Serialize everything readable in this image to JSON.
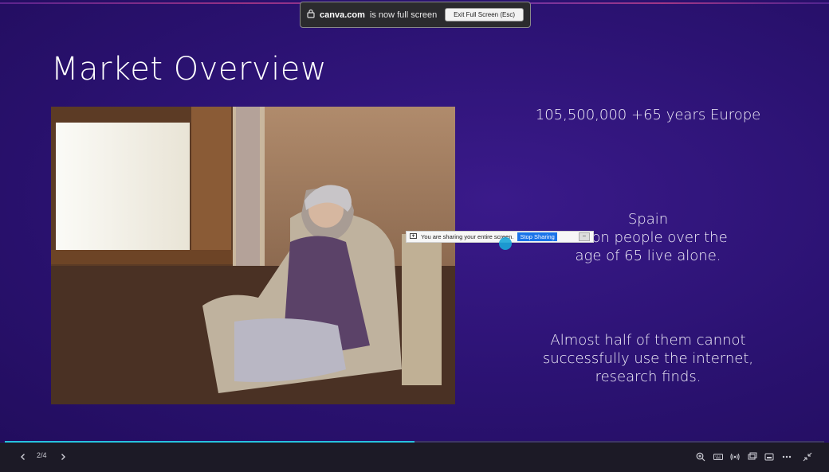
{
  "slide": {
    "title": "Market Overview",
    "stat_line": "105,500,000 +65 years Europe",
    "spain_lines": [
      "Spain",
      "ion people over the",
      "age of 65  live alone."
    ],
    "half_lines": [
      "Almost half of them cannot",
      "successfully use the internet,",
      "research finds."
    ]
  },
  "fullscreen_notice": {
    "domain": "canva.com",
    "text": "is now full screen",
    "exit_label": "Exit Full Screen (Esc)"
  },
  "sharing_bar": {
    "message": "You are sharing your entire screen.",
    "stop_label": "Stop Sharing",
    "hide_label": "–"
  },
  "player": {
    "page_indicator": "2/4",
    "progress_fraction": 0.5,
    "accent": "#27c2e0",
    "controls": [
      "zoom-icon",
      "keyboard-icon",
      "broadcast-icon",
      "present-icon",
      "fullscreen-icon",
      "more-icon",
      "exit-fullscreen-icon"
    ]
  }
}
